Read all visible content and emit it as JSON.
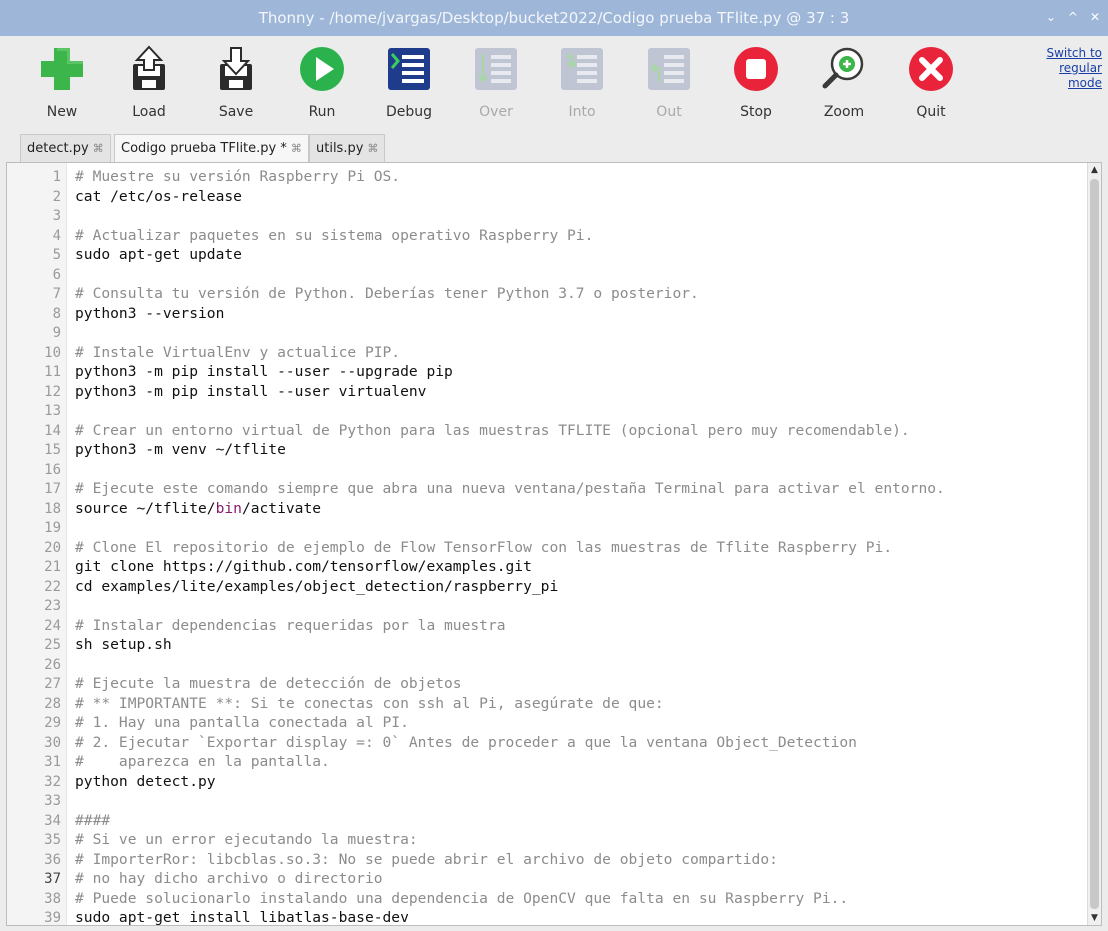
{
  "window": {
    "title": "Thonny  -  /home/jvargas/Desktop/bucket2022/Codigo prueba TFlite.py  @  37 : 3",
    "controls": [
      "⌄",
      "^",
      "✕"
    ]
  },
  "toolbar": {
    "buttons": [
      {
        "label": "New",
        "icon": "new-file-icon",
        "enabled": true
      },
      {
        "label": "Load",
        "icon": "load-icon",
        "enabled": true
      },
      {
        "label": "Save",
        "icon": "save-icon",
        "enabled": true
      },
      {
        "label": "Run",
        "icon": "run-icon",
        "enabled": true
      },
      {
        "label": "Debug",
        "icon": "debug-icon",
        "enabled": true
      },
      {
        "label": "Over",
        "icon": "step-over-icon",
        "enabled": false
      },
      {
        "label": "Into",
        "icon": "step-into-icon",
        "enabled": false
      },
      {
        "label": "Out",
        "icon": "step-out-icon",
        "enabled": false
      },
      {
        "label": "Stop",
        "icon": "stop-icon",
        "enabled": true
      },
      {
        "label": "Zoom",
        "icon": "zoom-icon",
        "enabled": true
      },
      {
        "label": "Quit",
        "icon": "quit-icon",
        "enabled": true
      }
    ],
    "switch_mode": {
      "line1": "Switch to",
      "line2": "regular",
      "line3": "mode"
    }
  },
  "tabs": [
    {
      "label": "detect.py",
      "close": "⌘",
      "active": false
    },
    {
      "label": "Codigo prueba TFlite.py *",
      "close": "⌘",
      "active": true
    },
    {
      "label": "utils.py",
      "close": "⌘",
      "active": false
    }
  ],
  "editor": {
    "current_line": 37,
    "lines": [
      "# Muestre su versión Raspberry Pi OS.",
      "cat /etc/os-release",
      "",
      "# Actualizar paquetes en su sistema operativo Raspberry Pi.",
      "sudo apt-get update",
      "",
      "# Consulta tu versión de Python. Deberías tener Python 3.7 o posterior.",
      "python3 --version",
      "",
      "# Instale VirtualEnv y actualice PIP.",
      "python3 -m pip install --user --upgrade pip",
      "python3 -m pip install --user virtualenv",
      "",
      "# Crear un entorno virtual de Python para las muestras TFLITE (opcional pero muy recomendable).",
      "python3 -m venv ~/tflite",
      "",
      "# Ejecute este comando siempre que abra una nueva ventana/pestaña Terminal para activar el entorno.",
      "source ~/tflite/bin/activate",
      "",
      "# Clone El repositorio de ejemplo de Flow TensorFlow con las muestras de Tflite Raspberry Pi.",
      "git clone https://github.com/tensorflow/examples.git",
      "cd examples/lite/examples/object_detection/raspberry_pi",
      "",
      "# Instalar dependencias requeridas por la muestra",
      "sh setup.sh",
      "",
      "# Ejecute la muestra de detección de objetos",
      "# ** IMPORTANTE **: Si te conectas con ssh al Pi, asegúrate de que:",
      "# 1. Hay una pantalla conectada al PI.",
      "# 2. Ejecutar `Exportar display =: 0` Antes de proceder a que la ventana Object_Detection",
      "#    aparezca en la pantalla.",
      "python detect.py",
      "",
      "####",
      "# Si ve un error ejecutando la muestra:",
      "# ImporterRor: libcblas.so.3: No se puede abrir el archivo de objeto compartido:",
      "# no hay dicho archivo o directorio",
      "# Puede solucionarlo instalando una dependencia de OpenCV que falta en su Raspberry Pi..",
      "sudo apt-get install libatlas-base-dev"
    ]
  },
  "colors": {
    "titlebar": "#9eb7d9",
    "comment": "#8c8c8c",
    "keyword": "#8b1a6b",
    "new_green": "#3cb54a",
    "run_green": "#2bb24c",
    "stop_red": "#e8233a"
  }
}
